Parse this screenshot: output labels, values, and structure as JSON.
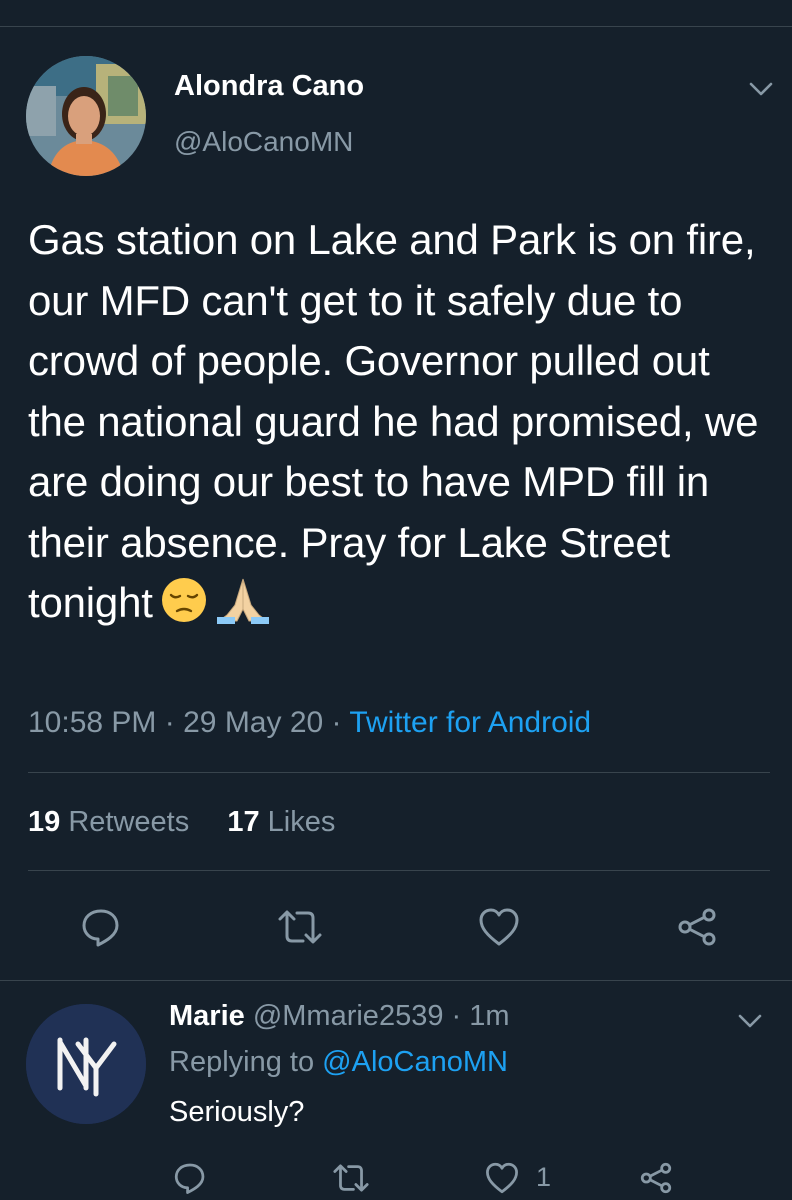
{
  "tweet": {
    "author_name": "Alondra Cano",
    "author_handle": "@AloCanoMN",
    "text": "Gas station on Lake and Park is on fire, our MFD can't get to it safely due to crowd of people. Governor pulled out the national guard he had promised, we are doing our best to have MPD fill in their absence. Pray for Lake Street tonight",
    "emojis": [
      "pensive-face",
      "folded-hands"
    ],
    "time": "10:58 PM",
    "date": "29 May 20",
    "separator": "·",
    "source": "Twitter for Android",
    "retweets_count": "19",
    "retweets_label": "Retweets",
    "likes_count": "17",
    "likes_label": "Likes"
  },
  "actions": [
    "reply-icon",
    "retweet-icon",
    "like-icon",
    "share-icon"
  ],
  "reply": {
    "name": "Marie",
    "handle": "@Mmarie2539",
    "separator": "·",
    "time": "1m",
    "replying_prefix": "Replying to",
    "replying_handle": "@AloCanoMN",
    "text": "Seriously?",
    "likes_count": "1"
  },
  "colors": {
    "background": "#15202b",
    "primary_text": "#ffffff",
    "secondary_text": "#8899a6",
    "link": "#1da1f2",
    "divider": "#38444d"
  }
}
